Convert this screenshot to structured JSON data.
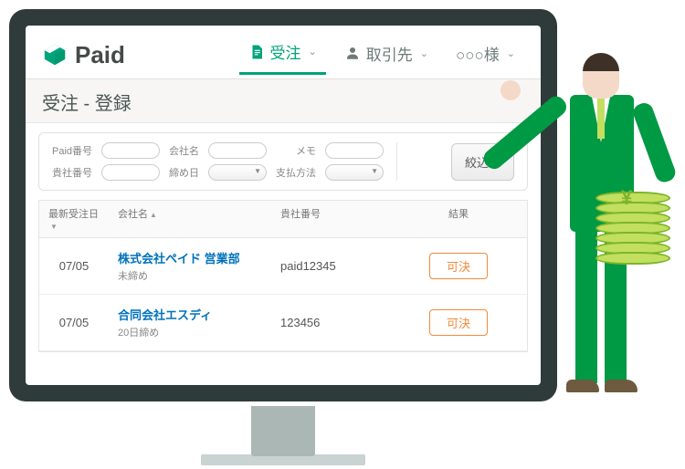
{
  "brand": {
    "name": "Paid"
  },
  "nav": {
    "orders_label": "受注",
    "partners_label": "取引先",
    "user_label": "○○○様"
  },
  "page": {
    "title": "受注 - 登録"
  },
  "filter": {
    "paid_no_label": "Paid番号",
    "company_label": "会社名",
    "memo_label": "メモ",
    "your_no_label": "貴社番号",
    "closing_label": "締め日",
    "payment_label": "支払方法",
    "search_btn": "絞込み"
  },
  "table": {
    "headers": {
      "date": "最新受注日",
      "company": "会社名",
      "your_no": "貴社番号",
      "result": "結果"
    },
    "rows": [
      {
        "date": "07/05",
        "company": "株式会社ペイド 営業部",
        "sub": "未締め",
        "your_no": "paid12345",
        "status": "可決"
      },
      {
        "date": "07/05",
        "company": "合同会社エスディ",
        "sub": "20日締め",
        "your_no": "123456",
        "status": "可決"
      }
    ]
  }
}
